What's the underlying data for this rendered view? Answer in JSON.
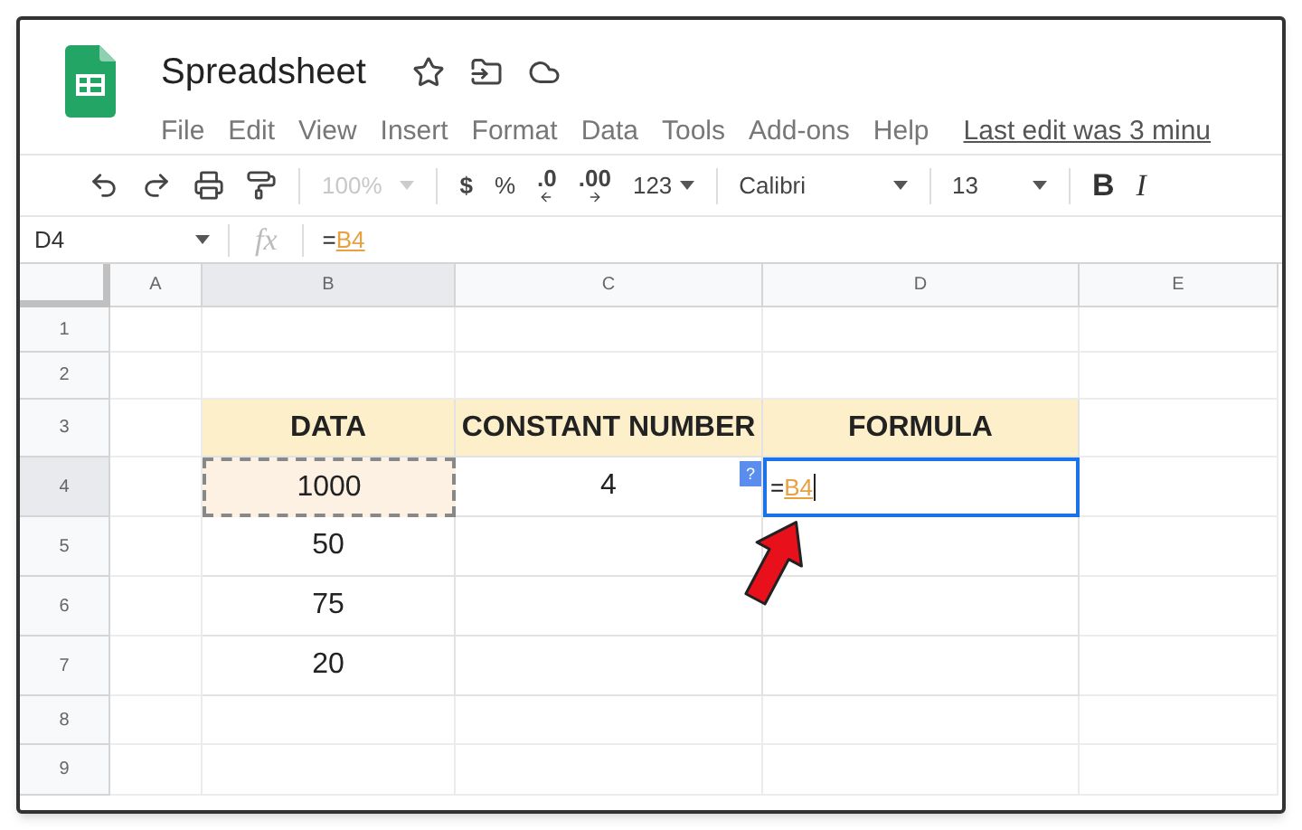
{
  "title": "Spreadsheet",
  "menu": [
    "File",
    "Edit",
    "View",
    "Insert",
    "Format",
    "Data",
    "Tools",
    "Add-ons",
    "Help"
  ],
  "last_edit": "Last edit was 3 minu",
  "toolbar": {
    "zoom": {
      "text": "100%",
      "disabled": true
    },
    "currency": "$",
    "percent": "%",
    "decrease_decimals": ".0",
    "increase_decimals": ".00",
    "number_format": "123",
    "font": "Calibri",
    "font_size": "13",
    "bold": "B",
    "italic": "I"
  },
  "name_box": "D4",
  "formula_icon": "fx",
  "formula": {
    "prefix": "=",
    "reference": "B4"
  },
  "columns": [
    {
      "label": "A",
      "selected": false
    },
    {
      "label": "B",
      "selected": true
    },
    {
      "label": "C",
      "selected": false
    },
    {
      "label": "D",
      "selected": false
    },
    {
      "label": "E",
      "selected": false
    }
  ],
  "rows": [
    {
      "label": "1",
      "selected": false,
      "cells": [
        {
          "kind": "empty"
        },
        {
          "kind": "empty"
        },
        {
          "kind": "empty"
        },
        {
          "kind": "empty"
        },
        {
          "kind": "empty"
        }
      ]
    },
    {
      "label": "2",
      "selected": false,
      "cells": [
        {
          "kind": "empty"
        },
        {
          "kind": "empty"
        },
        {
          "kind": "empty"
        },
        {
          "kind": "empty"
        },
        {
          "kind": "empty"
        }
      ]
    },
    {
      "label": "3",
      "selected": false,
      "cells": [
        {
          "kind": "empty"
        },
        {
          "kind": "header",
          "text": "DATA"
        },
        {
          "kind": "header",
          "text": "CONSTANT NUMBER"
        },
        {
          "kind": "header",
          "text": "FORMULA"
        },
        {
          "kind": "empty"
        }
      ]
    },
    {
      "label": "4",
      "selected": true,
      "cells": [
        {
          "kind": "empty"
        },
        {
          "kind": "copied",
          "text": "1000"
        },
        {
          "kind": "value",
          "text": "4"
        },
        {
          "kind": "editing",
          "prefix": "=",
          "reference": "B4",
          "hint": "?"
        },
        {
          "kind": "empty"
        }
      ]
    },
    {
      "label": "5",
      "selected": false,
      "cells": [
        {
          "kind": "empty"
        },
        {
          "kind": "value",
          "text": "50"
        },
        {
          "kind": "value"
        },
        {
          "kind": "value"
        },
        {
          "kind": "empty"
        }
      ]
    },
    {
      "label": "6",
      "selected": false,
      "cells": [
        {
          "kind": "empty"
        },
        {
          "kind": "value",
          "text": "75"
        },
        {
          "kind": "value"
        },
        {
          "kind": "value"
        },
        {
          "kind": "empty"
        }
      ]
    },
    {
      "label": "7",
      "selected": false,
      "cells": [
        {
          "kind": "empty"
        },
        {
          "kind": "value",
          "text": "20"
        },
        {
          "kind": "value"
        },
        {
          "kind": "value"
        },
        {
          "kind": "empty"
        }
      ]
    },
    {
      "label": "8",
      "selected": false,
      "cells": [
        {
          "kind": "empty"
        },
        {
          "kind": "empty"
        },
        {
          "kind": "empty"
        },
        {
          "kind": "empty"
        },
        {
          "kind": "empty"
        }
      ]
    },
    {
      "label": "9",
      "selected": false,
      "cells": [
        {
          "kind": "empty"
        },
        {
          "kind": "empty"
        },
        {
          "kind": "empty"
        },
        {
          "kind": "empty"
        },
        {
          "kind": "empty"
        }
      ]
    }
  ]
}
